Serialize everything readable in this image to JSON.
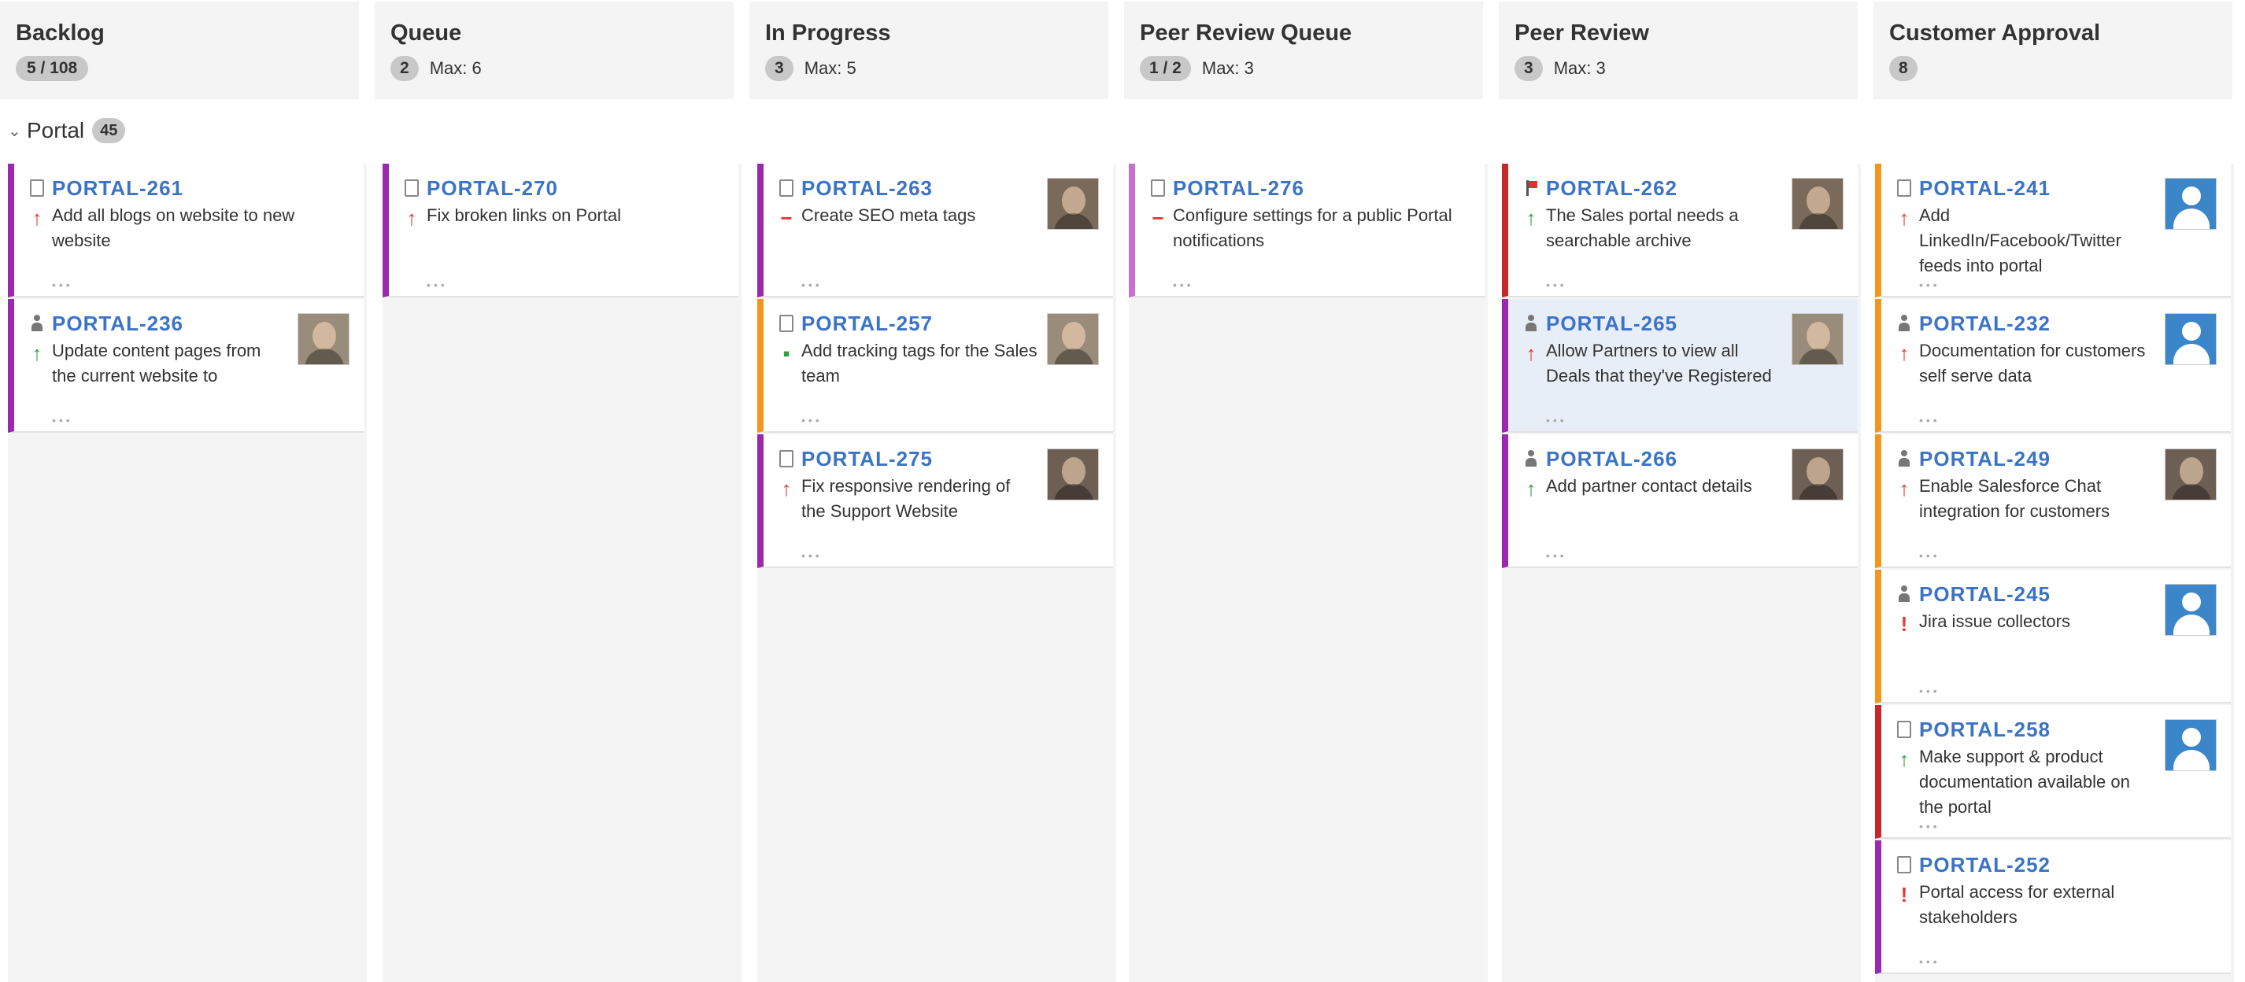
{
  "columns": [
    {
      "title": "Backlog",
      "count": "5 / 108",
      "max": ""
    },
    {
      "title": "Queue",
      "count": "2",
      "max": "Max: 6"
    },
    {
      "title": "In Progress",
      "count": "3",
      "max": "Max: 5"
    },
    {
      "title": "Peer Review Queue",
      "count": "1 / 2",
      "max": "Max: 3"
    },
    {
      "title": "Peer Review",
      "count": "3",
      "max": "Max: 3"
    },
    {
      "title": "Customer Approval",
      "count": "8",
      "max": ""
    }
  ],
  "swimlane": {
    "name": "Portal",
    "count": "45"
  },
  "cards": {
    "backlog": [
      {
        "key": "PORTAL-261",
        "summary": "Add all blogs on website to new website",
        "priority_icon": "arrow-up",
        "type_icon": "task-icon",
        "accent": "#9c27b0",
        "avatar": ""
      },
      {
        "key": "PORTAL-236",
        "summary": "Update content pages from the current website to",
        "priority_icon": "arrow-up-green",
        "type_icon": "user-icon",
        "accent": "#9c27b0",
        "avatar": "photo"
      }
    ],
    "queue": [
      {
        "key": "PORTAL-270",
        "summary": "Fix broken links on Portal",
        "priority_icon": "arrow-up",
        "type_icon": "task-icon",
        "accent": "#9c27b0",
        "avatar": ""
      }
    ],
    "in_progress": [
      {
        "key": "PORTAL-263",
        "summary": "Create SEO meta tags",
        "priority_icon": "minus",
        "type_icon": "task-icon",
        "accent": "#9c27b0",
        "avatar": "photo"
      },
      {
        "key": "PORTAL-257",
        "summary": "Add tracking tags for the Sales team",
        "priority_icon": "square",
        "type_icon": "task-icon",
        "accent": "#f4951d",
        "avatar": "photo"
      },
      {
        "key": "PORTAL-275",
        "summary": "Fix responsive rendering of the Support Website",
        "priority_icon": "arrow-up",
        "type_icon": "task-icon",
        "accent": "#9c27b0",
        "avatar": "photo"
      }
    ],
    "peer_review_queue": [
      {
        "key": "PORTAL-276",
        "summary": "Configure settings for a public Portal notifications",
        "priority_icon": "minus",
        "type_icon": "task-icon",
        "accent": "#c770d0",
        "avatar": ""
      }
    ],
    "peer_review": [
      {
        "key": "PORTAL-262",
        "summary": "The Sales portal needs a searchable archive",
        "priority_icon": "arrow-up-green",
        "type_icon": "flag-icon",
        "accent": "#c62828",
        "avatar": "photo"
      },
      {
        "key": "PORTAL-265",
        "summary": "Allow Partners to view all Deals that they've Registered",
        "priority_icon": "arrow-up",
        "type_icon": "user-icon",
        "accent": "#9c27b0",
        "avatar": "photo",
        "selected": true
      },
      {
        "key": "PORTAL-266",
        "summary": "Add partner contact details",
        "priority_icon": "arrow-up-green",
        "type_icon": "user-icon",
        "accent": "#9c27b0",
        "avatar": "photo"
      }
    ],
    "customer_approval": [
      {
        "key": "PORTAL-241",
        "summary": "Add LinkedIn/Facebook/Twitter feeds into portal",
        "priority_icon": "arrow-up",
        "type_icon": "task-icon",
        "accent": "#f4951d",
        "avatar": "generic"
      },
      {
        "key": "PORTAL-232",
        "summary": "Documentation for customers self serve data",
        "priority_icon": "arrow-up",
        "type_icon": "user-icon",
        "accent": "#f4951d",
        "avatar": "generic"
      },
      {
        "key": "PORTAL-249",
        "summary": "Enable Salesforce Chat integration for customers",
        "priority_icon": "arrow-up",
        "type_icon": "user-icon",
        "accent": "#f4951d",
        "avatar": "photo"
      },
      {
        "key": "PORTAL-245",
        "summary": "Jira issue collectors",
        "priority_icon": "exclaim",
        "type_icon": "user-icon",
        "accent": "#f4951d",
        "avatar": "generic"
      },
      {
        "key": "PORTAL-258",
        "summary": "Make support & product documentation available on the portal",
        "priority_icon": "arrow-up-green",
        "type_icon": "task-icon",
        "accent": "#c62828",
        "avatar": "generic"
      },
      {
        "key": "PORTAL-252",
        "summary": "Portal access for external stakeholders",
        "priority_icon": "exclaim",
        "type_icon": "task-icon",
        "accent": "#9c27b0",
        "avatar": ""
      }
    ]
  },
  "colors": {
    "link": "#3b73c6",
    "purple": "#9c27b0",
    "orange": "#f4951d",
    "red": "#c62828",
    "light_purple": "#c770d0",
    "green": "#2e9e3e",
    "priority_red": "#e53935"
  }
}
